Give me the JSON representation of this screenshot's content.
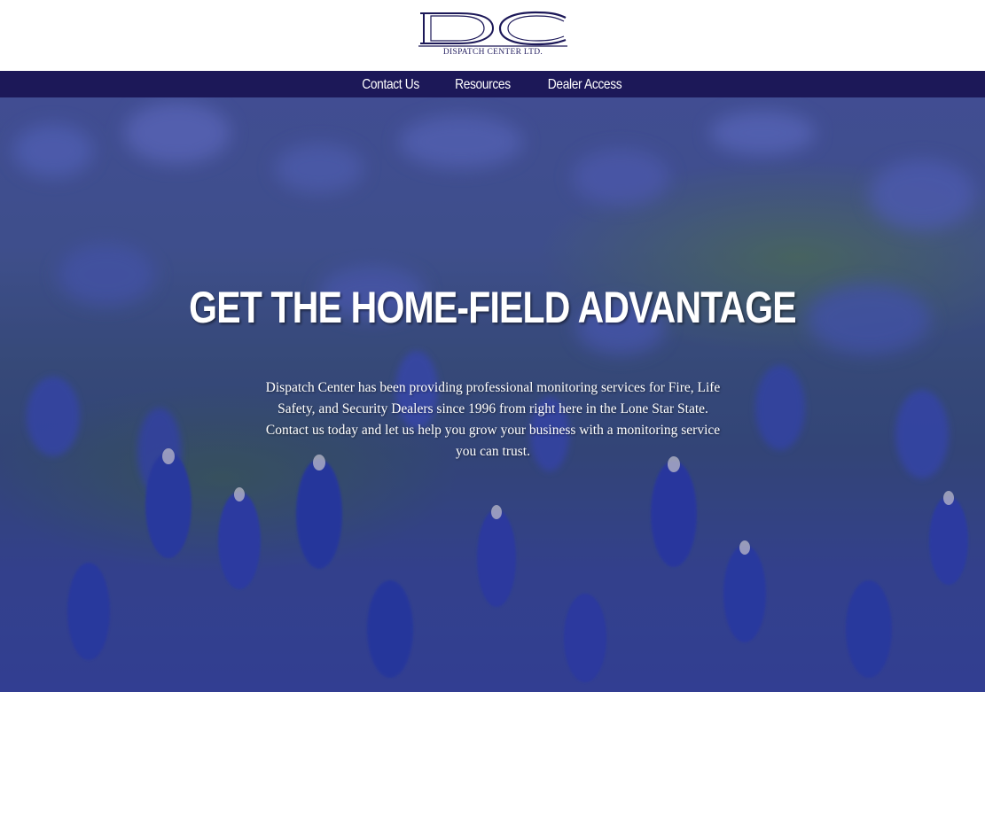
{
  "brand": {
    "logo_text": "DC",
    "logo_subtitle": "DISPATCH CENTER LTD.",
    "navy": "#1c1858"
  },
  "nav": {
    "items": [
      {
        "label": "Contact Us"
      },
      {
        "label": "Resources"
      },
      {
        "label": "Dealer Access"
      }
    ]
  },
  "hero": {
    "title": "GET THE HOME-FIELD ADVANTAGE",
    "body": "Dispatch Center has been providing professional monitoring services for Fire, Life Safety, and Security Dealers since 1996 from right here in the Lone Star State. Contact us today and let us help you grow your business with a monitoring service you can trust.",
    "background_image": "bluebonnet-field-photo"
  }
}
